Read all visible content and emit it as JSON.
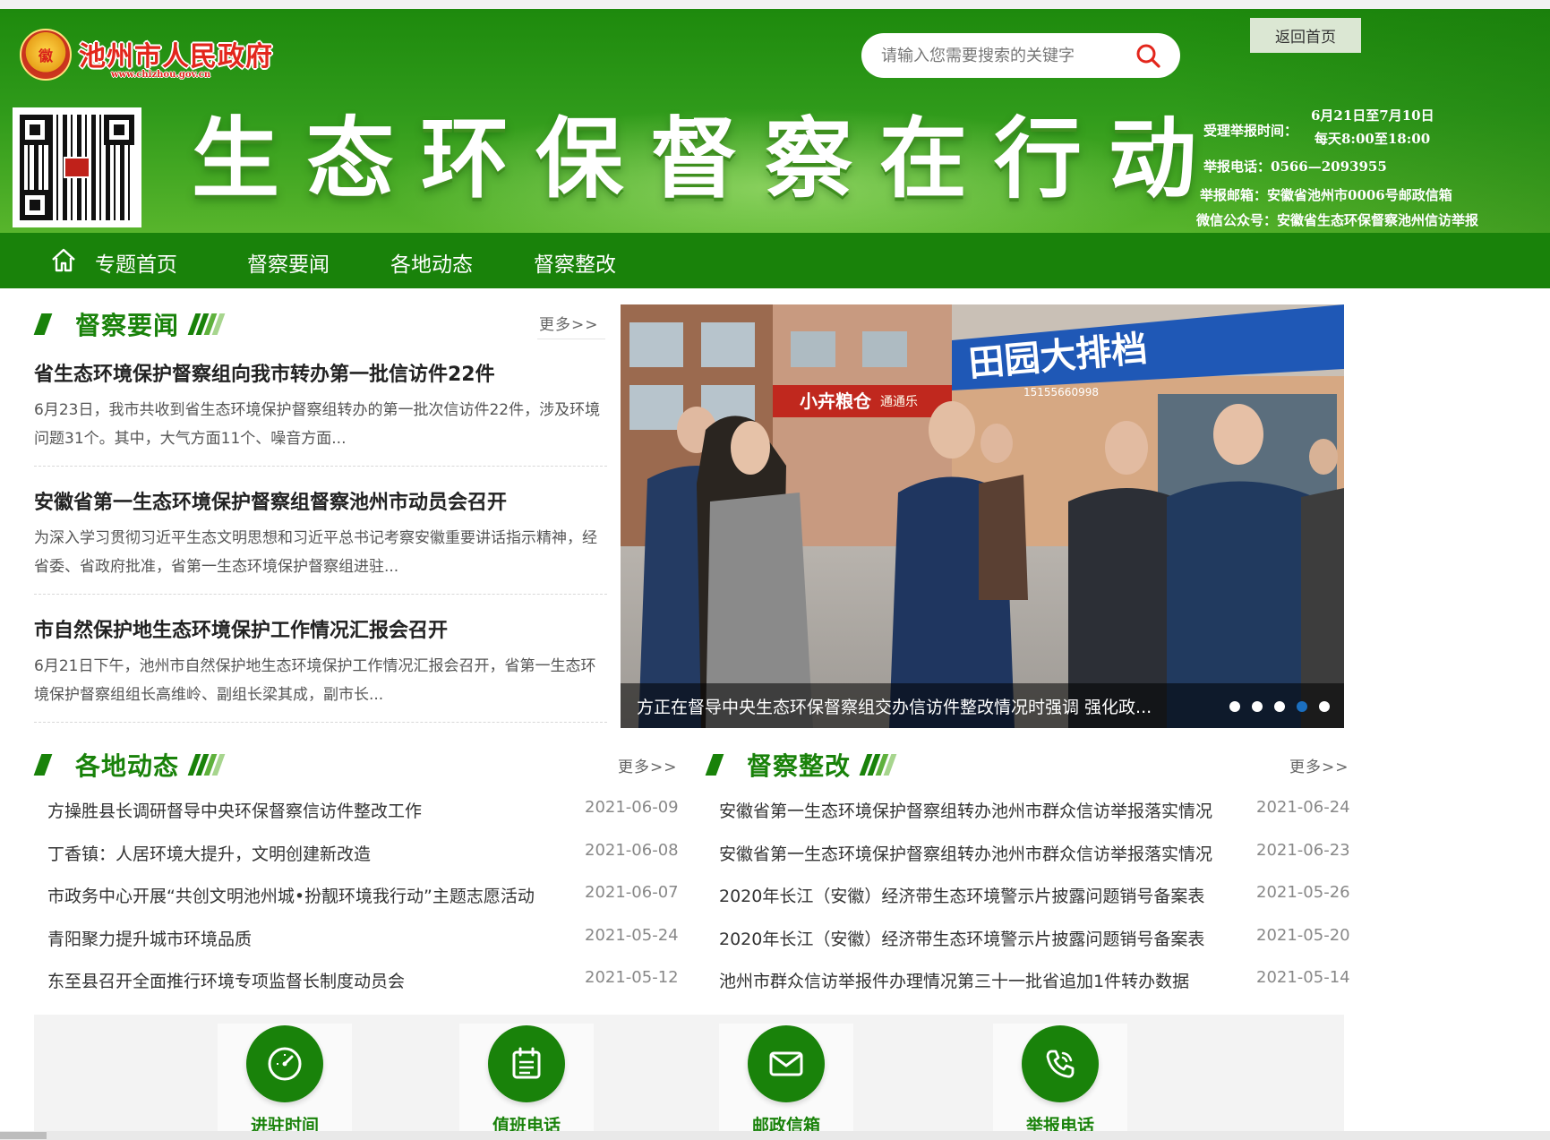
{
  "header": {
    "site_name": "池州市人民政府",
    "site_url": "www.chizhou.gov.cn",
    "emblem_glyph": "徽",
    "hero_title": "生态环保督察在行动",
    "search_placeholder": "请输入您需要搜索的关键字",
    "home_link": "返回首页",
    "info": {
      "time_label": "受理举报时间：",
      "time_dates": "6月21日至7月10日",
      "time_hours": "每天8:00至18:00",
      "phone": "举报电话：0566—2093955",
      "mailbox": "举报邮箱：安徽省池州市0006号邮政信箱",
      "wechat": "微信公众号：安徽省生态环保督察池州信访举报"
    }
  },
  "nav": {
    "items": [
      {
        "label": "专题首页"
      },
      {
        "label": "督察要闻"
      },
      {
        "label": "各地动态"
      },
      {
        "label": "督察整改"
      }
    ]
  },
  "news_section": {
    "title": "督察要闻",
    "more": "更多>>",
    "items": [
      {
        "title": "省生态环境保护督察组向我市转办第一批信访件22件",
        "summary": "6月23日，我市共收到省生态环境保护督察组转办的第一批次信访件22件，涉及环境问题31个。其中，大气方面11个、噪音方面..."
      },
      {
        "title": "安徽省第一生态环境保护督察组督察池州市动员会召开",
        "summary": "为深入学习贯彻习近平生态文明思想和习近平总书记考察安徽重要讲话指示精神，经省委、省政府批准，省第一生态环境保护督察组进驻..."
      },
      {
        "title": "市自然保护地生态环境保护工作情况汇报会召开",
        "summary": "6月21日下午，池州市自然保护地生态环境保护工作情况汇报会召开，省第一生态环境保护督察组组长高维岭、副组长梁其成，副市长..."
      }
    ]
  },
  "slider": {
    "caption": "方正在督导中央生态环保督察组交办信访件整改情况时强调 强化政...",
    "dot_count": 5,
    "active_dot": 3,
    "sign_text": "田园大排档",
    "sign_phone": "15155660998",
    "shop_sign": "小卉粮仓",
    "shop_sign2": "通通乐"
  },
  "local_section": {
    "title": "各地动态",
    "more": "更多>>",
    "items": [
      {
        "title": "方操胜县长调研督导中央环保督察信访件整改工作",
        "date": "2021-06-09"
      },
      {
        "title": "丁香镇：人居环境大提升，文明创建新改造",
        "date": "2021-06-08"
      },
      {
        "title": "市政务中心开展“共创文明池州城•扮靓环境我行动”主题志愿活动",
        "date": "2021-06-07"
      },
      {
        "title": "青阳聚力提升城市环境品质",
        "date": "2021-05-24"
      },
      {
        "title": "东至县召开全面推行环境专项监督长制度动员会",
        "date": "2021-05-12"
      }
    ]
  },
  "rectify_section": {
    "title": "督察整改",
    "more": "更多>>",
    "items": [
      {
        "title": "安徽省第一生态环境保护督察组转办池州市群众信访举报落实情况",
        "date": "2021-06-24"
      },
      {
        "title": "安徽省第一生态环境保护督察组转办池州市群众信访举报落实情况",
        "date": "2021-06-23"
      },
      {
        "title": "2020年长江（安徽）经济带生态环境警示片披露问题销号备案表",
        "date": "2021-05-26"
      },
      {
        "title": "2020年长江（安徽）经济带生态环境警示片披露问题销号备案表",
        "date": "2021-05-20"
      },
      {
        "title": "池州市群众信访举报件办理情况第三十一批省追加1件转办数据",
        "date": "2021-05-14"
      }
    ]
  },
  "services": [
    {
      "label": "进驻时间",
      "icon": "clock-gauge-icon"
    },
    {
      "label": "值班电话",
      "icon": "calendar-icon"
    },
    {
      "label": "邮政信箱",
      "icon": "mail-icon"
    },
    {
      "label": "举报电话",
      "icon": "phone-icon"
    }
  ],
  "colors": {
    "primary_green": "#19820a",
    "banner_light": "#58b52c",
    "accent_red": "#e3261c",
    "active_dot": "#1b6fbf"
  }
}
